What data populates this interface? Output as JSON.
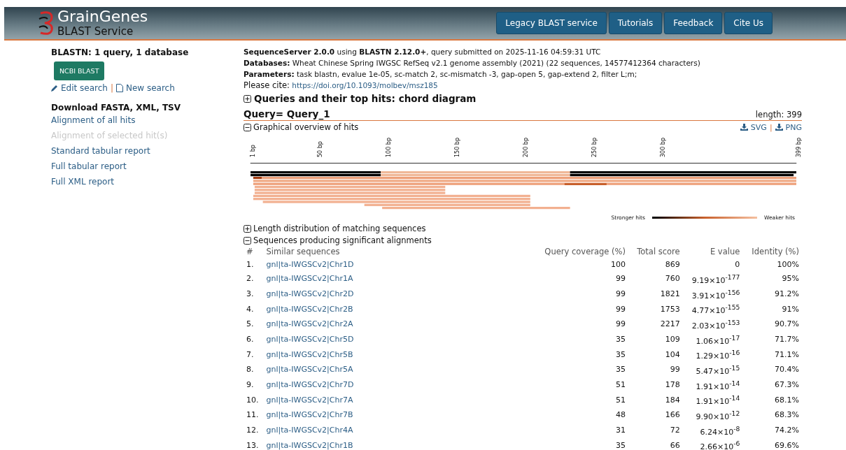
{
  "header": {
    "logo_title": "GrainGenes",
    "logo_subtitle": "BLAST Service",
    "nav": [
      "Legacy BLAST service",
      "Tutorials",
      "Feedback",
      "Cite Us"
    ]
  },
  "sidebar": {
    "title": "BLASTN: 1 query, 1 database",
    "ncbi_button": "NCBI BLAST",
    "edit_link": "Edit search",
    "separator": "|",
    "new_link": "New search",
    "download_title": "Download FASTA, XML, TSV",
    "links": [
      {
        "label": "Alignment of all hits",
        "disabled": false
      },
      {
        "label": "Alignment of selected hit(s)",
        "disabled": true
      },
      {
        "label": "Standard tabular report",
        "disabled": false
      },
      {
        "label": "Full tabular report",
        "disabled": false
      },
      {
        "label": "Full XML report",
        "disabled": false
      }
    ]
  },
  "info": [
    "**SequenceServer 2.0.0** using **BLASTN 2.12.0+**, query submitted on 2025-11-16 04:59:31 UTC",
    "**Databases:** Wheat Chinese Spring IWGSC RefSeq v2.1 genome assembly (2021) (22 sequences, 14577412364 characters)",
    "**Parameters:** task blastn, evalue 1e-05, sc-match 2, sc-mismatch -3, gap-open 5, gap-extend 2, filter L;m;"
  ],
  "cite": {
    "label": "Please cite:",
    "link": "https://doi.org/10.1093/molbev/msz185"
  },
  "chord_section": {
    "title": "Queries and their top hits: chord diagram",
    "expanded": false
  },
  "query": {
    "title": "Query= Query_1",
    "length": "length: 399"
  },
  "overview": {
    "title": "Graphical overview of hits",
    "expanded": true,
    "svg": "SVG",
    "sep": "|",
    "png": "PNG",
    "ticks": [
      "1 bp",
      "50 bp",
      "100 bp",
      "150 bp",
      "200 bp",
      "250 bp",
      "300 bp",
      "399 bp"
    ],
    "legend_strong": "Stronger hits",
    "legend_weak": "Weaker hits"
  },
  "length_section": {
    "title": "Length distribution of matching sequences",
    "expanded": false
  },
  "alignments_section": {
    "title": "Sequences producing significant alignments",
    "expanded": true
  },
  "table": {
    "columns": [
      "#",
      "Similar sequences",
      "Query coverage (%)",
      "Total score",
      "E value",
      "Identity (%)"
    ],
    "rows": [
      [
        "1.",
        "gnl|ta-IWGSCv2|Chr1D",
        "100",
        "869",
        "0",
        "100%"
      ],
      [
        "2.",
        "gnl|ta-IWGSCv2|Chr1A",
        "99",
        "760",
        "9.19×10$^{-177}$",
        "95%"
      ],
      [
        "3.",
        "gnl|ta-IWGSCv2|Chr2D",
        "99",
        "1821",
        "3.91×10$^{-156}$",
        "91.2%"
      ],
      [
        "4.",
        "gnl|ta-IWGSCv2|Chr2B",
        "99",
        "1753",
        "4.77×10$^{-155}$",
        "91%"
      ],
      [
        "5.",
        "gnl|ta-IWGSCv2|Chr2A",
        "99",
        "2217",
        "2.03×10$^{-153}$",
        "90.7%"
      ],
      [
        "6.",
        "gnl|ta-IWGSCv2|Chr5D",
        "35",
        "109",
        "1.06×10$^{-17}$",
        "71.7%"
      ],
      [
        "7.",
        "gnl|ta-IWGSCv2|Chr5B",
        "35",
        "104",
        "1.29×10$^{-16}$",
        "71.1%"
      ],
      [
        "8.",
        "gnl|ta-IWGSCv2|Chr5A",
        "35",
        "99",
        "5.47×10$^{-15}$",
        "70.4%"
      ],
      [
        "9.",
        "gnl|ta-IWGSCv2|Chr7D",
        "51",
        "178",
        "1.91×10$^{-14}$",
        "67.3%"
      ],
      [
        "10.",
        "gnl|ta-IWGSCv2|Chr7A",
        "51",
        "184",
        "1.91×10$^{-14}$",
        "68.1%"
      ],
      [
        "11.",
        "gnl|ta-IWGSCv2|Chr7B",
        "48",
        "166",
        "9.90×10$^{-12}$",
        "68.3%"
      ],
      [
        "12.",
        "gnl|ta-IWGSCv2|Chr4A",
        "31",
        "72",
        "6.24×10$^{-8}$",
        "74.2%"
      ],
      [
        "13.",
        "gnl|ta-IWGSCv2|Chr1B",
        "35",
        "66",
        "2.66×10$^{-6}$",
        "69.6%"
      ]
    ]
  }
}
